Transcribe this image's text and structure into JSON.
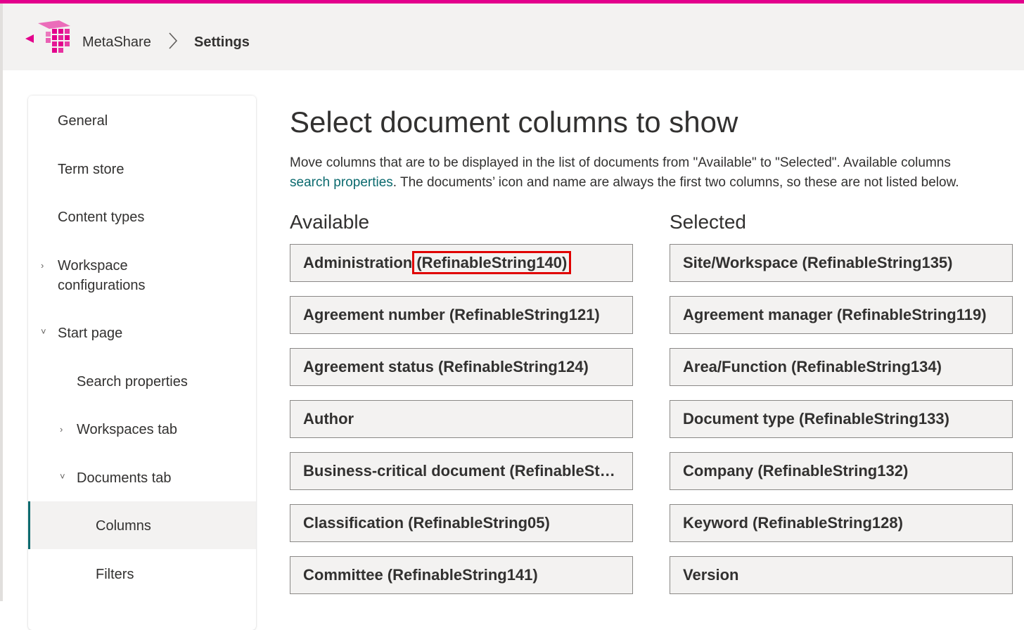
{
  "colors": {
    "accent": "#e3008c",
    "link": "#0b6a6e",
    "highlight": "#e00000"
  },
  "header": {
    "app_name": "MetaShare",
    "current_page": "Settings",
    "logo_icon": "metashare-logo-icon",
    "separator_icon": "chevron-right-icon"
  },
  "nav": {
    "items": [
      {
        "label": "General"
      },
      {
        "label": "Term store"
      },
      {
        "label": "Content types"
      },
      {
        "label_line1": "Workspace",
        "label_line2": "configurations",
        "chevron": "›"
      },
      {
        "label": "Start page",
        "chevron": "˅"
      },
      {
        "label": "Search properties"
      },
      {
        "label": "Workspaces tab",
        "chevron": "›"
      },
      {
        "label": "Documents tab",
        "chevron": "˅"
      },
      {
        "label": "Columns",
        "selected": true
      },
      {
        "label": "Filters"
      }
    ]
  },
  "main": {
    "title": "Select document columns to show",
    "desc_line1": "Move columns that are to be displayed in the list of documents from \"Available\" to \"Selected\". Available columns",
    "desc_link": "search properties",
    "desc_line2_rest": ". The documents’ icon and name are always the first two columns, so these are not listed below.",
    "available_heading": "Available",
    "selected_heading": "Selected",
    "available": [
      {
        "name": "Administration",
        "prop": "(RefinableString140)"
      },
      {
        "label": "Agreement number (RefinableString121)"
      },
      {
        "label": "Agreement status (RefinableString124)"
      },
      {
        "label": "Author"
      },
      {
        "label": "Business-critical document (RefinableSt…"
      },
      {
        "label": "Classification (RefinableString05)"
      },
      {
        "label": "Committee (RefinableString141)"
      }
    ],
    "selected": [
      {
        "label": "Site/Workspace (RefinableString135)"
      },
      {
        "label": "Agreement manager (RefinableString119)"
      },
      {
        "label": "Area/Function (RefinableString134)"
      },
      {
        "label": "Document type (RefinableString133)"
      },
      {
        "label": "Company (RefinableString132)"
      },
      {
        "label": "Keyword (RefinableString128)"
      },
      {
        "label": "Version"
      }
    ]
  }
}
